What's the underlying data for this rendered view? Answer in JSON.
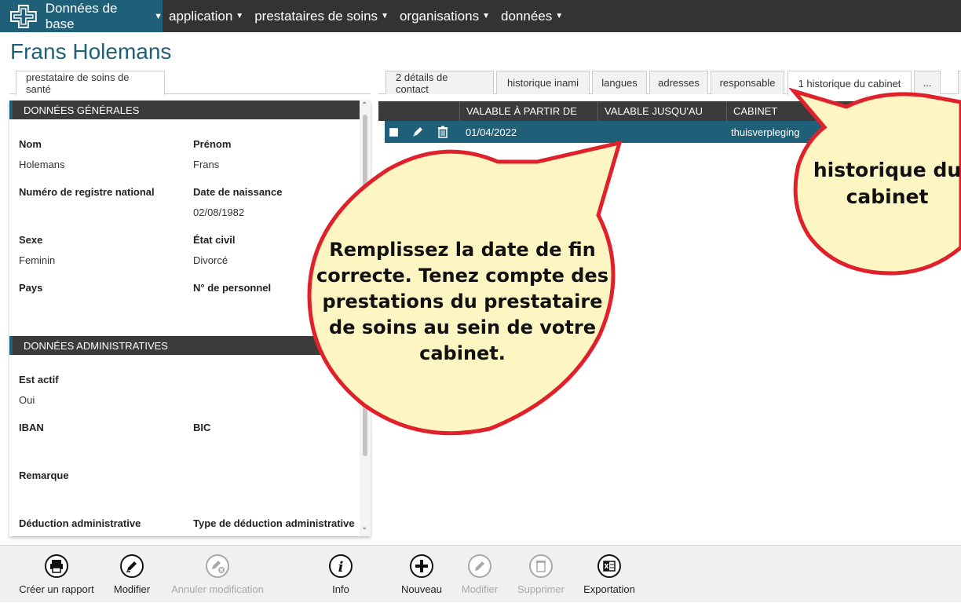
{
  "nav": {
    "brand_label": "Données de base",
    "items": [
      {
        "label": "application"
      },
      {
        "label": "prestataires de soins"
      },
      {
        "label": "organisations"
      },
      {
        "label": "données"
      }
    ]
  },
  "page": {
    "title": "Frans Holemans"
  },
  "left_tab": {
    "label": "prestataire de soins de santé"
  },
  "general": {
    "header": "DONNÉES GÉNÉRALES",
    "nom_label": "Nom",
    "nom_value": "Holemans",
    "prenom_label": "Prénom",
    "prenom_value": "Frans",
    "registre_label": "Numéro de registre national",
    "registre_value": "",
    "naissance_label": "Date de naissance",
    "naissance_value": "02/08/1982",
    "sexe_label": "Sexe",
    "sexe_value": "Feminin",
    "etat_label": "État civil",
    "etat_value": "Divorcé",
    "pays_label": "Pays",
    "pays_value": "",
    "personnel_label": "N° de personnel",
    "personnel_value": ""
  },
  "admin": {
    "header": "DONNÉES ADMINISTRATIVES",
    "actif_label": "Est actif",
    "actif_value": "Oui",
    "iban_label": "IBAN",
    "iban_value": "",
    "bic_label": "BIC",
    "bic_value": "",
    "remarque_label": "Remarque",
    "remarque_value": "",
    "deduction_label": "Déduction administrative",
    "type_deduction_label": "Type de déduction administrative"
  },
  "right_tabs": [
    {
      "label": "2 détails de contact"
    },
    {
      "label": "historique inami"
    },
    {
      "label": "langues"
    },
    {
      "label": "adresses"
    },
    {
      "label": "responsable"
    },
    {
      "label": "1 historique du cabinet"
    },
    {
      "label": "..."
    }
  ],
  "grid": {
    "columns": [
      "VALABLE À PARTIR DE",
      "VALABLE JUSQU'AU",
      "CABINET"
    ],
    "rows": [
      {
        "valid_from": "01/04/2022",
        "valid_until": "",
        "cabinet": "thuisverpleging"
      }
    ]
  },
  "callouts": {
    "main": "Remplissez la date de fin correcte. Tenez compte des prestations du prestataire de soins au sein de votre cabinet.",
    "tab_hint": "historique du cabinet"
  },
  "toolbar": {
    "report": "Créer un rapport",
    "edit": "Modifier",
    "cancel_edit": "Annuler modification",
    "info": "Info",
    "new": "Nouveau",
    "edit2": "Modifier",
    "delete": "Supprimer",
    "export": "Exportation"
  },
  "colors": {
    "accent": "#1f5f78",
    "dark": "#333333",
    "callout_fill": "#fdf6c3",
    "callout_border": "#e0202a"
  }
}
